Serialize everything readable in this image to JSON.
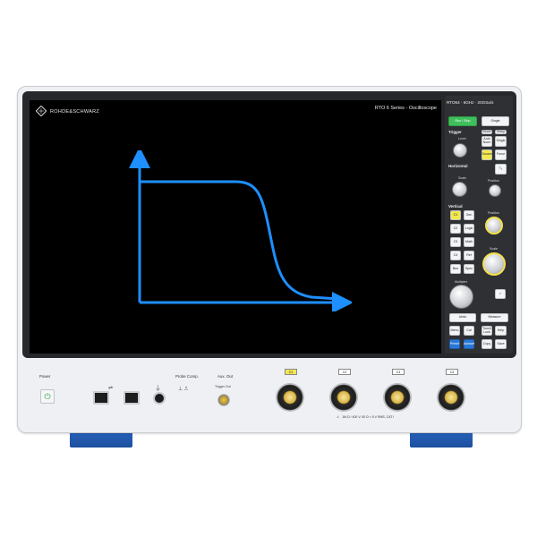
{
  "brand": {
    "name": "ROHDE&SCHWARZ",
    "logo_icon": "rs-diamond-logo"
  },
  "screen": {
    "title": "RTO 6 Series - Oscilloscope",
    "background": "#000000",
    "trace_color": "#1e8fff"
  },
  "panel": {
    "header": "RTO64 · 6GHz · 20GSa/s",
    "run_stop": "Run / Stop",
    "single": "Single",
    "trigger": {
      "label": "Trigger",
      "level": "Level",
      "mode": "Mode",
      "setup": "Setup",
      "auto_norm": "Auto Norm",
      "single_btn": "Single",
      "source": "Source",
      "force": "Force"
    },
    "horizontal": {
      "label": "Horizontal",
      "scale": "Scale",
      "position": "Position",
      "zoom": "Zoom",
      "acq": "Acq"
    },
    "vertical": {
      "label": "Vertical",
      "position": "Position",
      "scale": "Scale",
      "buttons": [
        "C1",
        "Gen",
        "C2",
        "Logic",
        "C3",
        "Math",
        "C4",
        "Ref",
        "Bus",
        "Spec"
      ]
    },
    "multiplex": "Multiplex",
    "bottom": [
      "Undo",
      "Measure",
      "Menu",
      "Cal",
      "Touch Lock",
      "Help",
      "Preset",
      "Autoset",
      "Copy",
      "Save"
    ]
  },
  "front": {
    "power": "Power",
    "probe_comp": "Probe Comp.",
    "aux_out": "Aux. Out",
    "aux_sub": "Trigger Out",
    "channels": [
      "C1",
      "C2",
      "C3",
      "C4"
    ],
    "warning": "1M Ω / 400 V, 50 Ω < 5 V RMS, CAT I"
  }
}
